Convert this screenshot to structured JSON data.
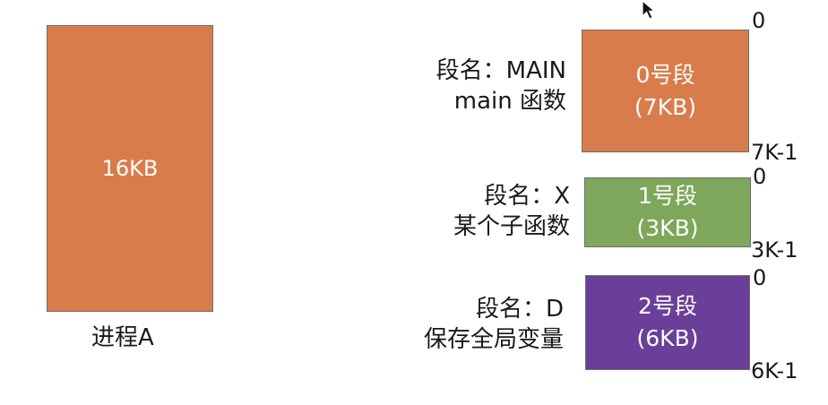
{
  "process": {
    "size": "16KB",
    "label": "进程A",
    "color": "#d97c4c"
  },
  "segments": [
    {
      "desc_line1": "段名：MAIN",
      "desc_line2": "main 函数",
      "title": "0号段",
      "size": "(7KB)",
      "start": "0",
      "end": "7K-1",
      "color": "#d97c4c"
    },
    {
      "desc_line1": "段名：X",
      "desc_line2": "某个子函数",
      "title": "1号段",
      "size": "(3KB)",
      "start": "0",
      "end": "3K-1",
      "color": "#7fa75c"
    },
    {
      "desc_line1": "段名：D",
      "desc_line2": "保存全局变量",
      "title": "2号段",
      "size": "(6KB)",
      "start": "0",
      "end": "6K-1",
      "color": "#6a3f99"
    }
  ],
  "cursor": {
    "icon": "mouse-pointer-icon"
  }
}
